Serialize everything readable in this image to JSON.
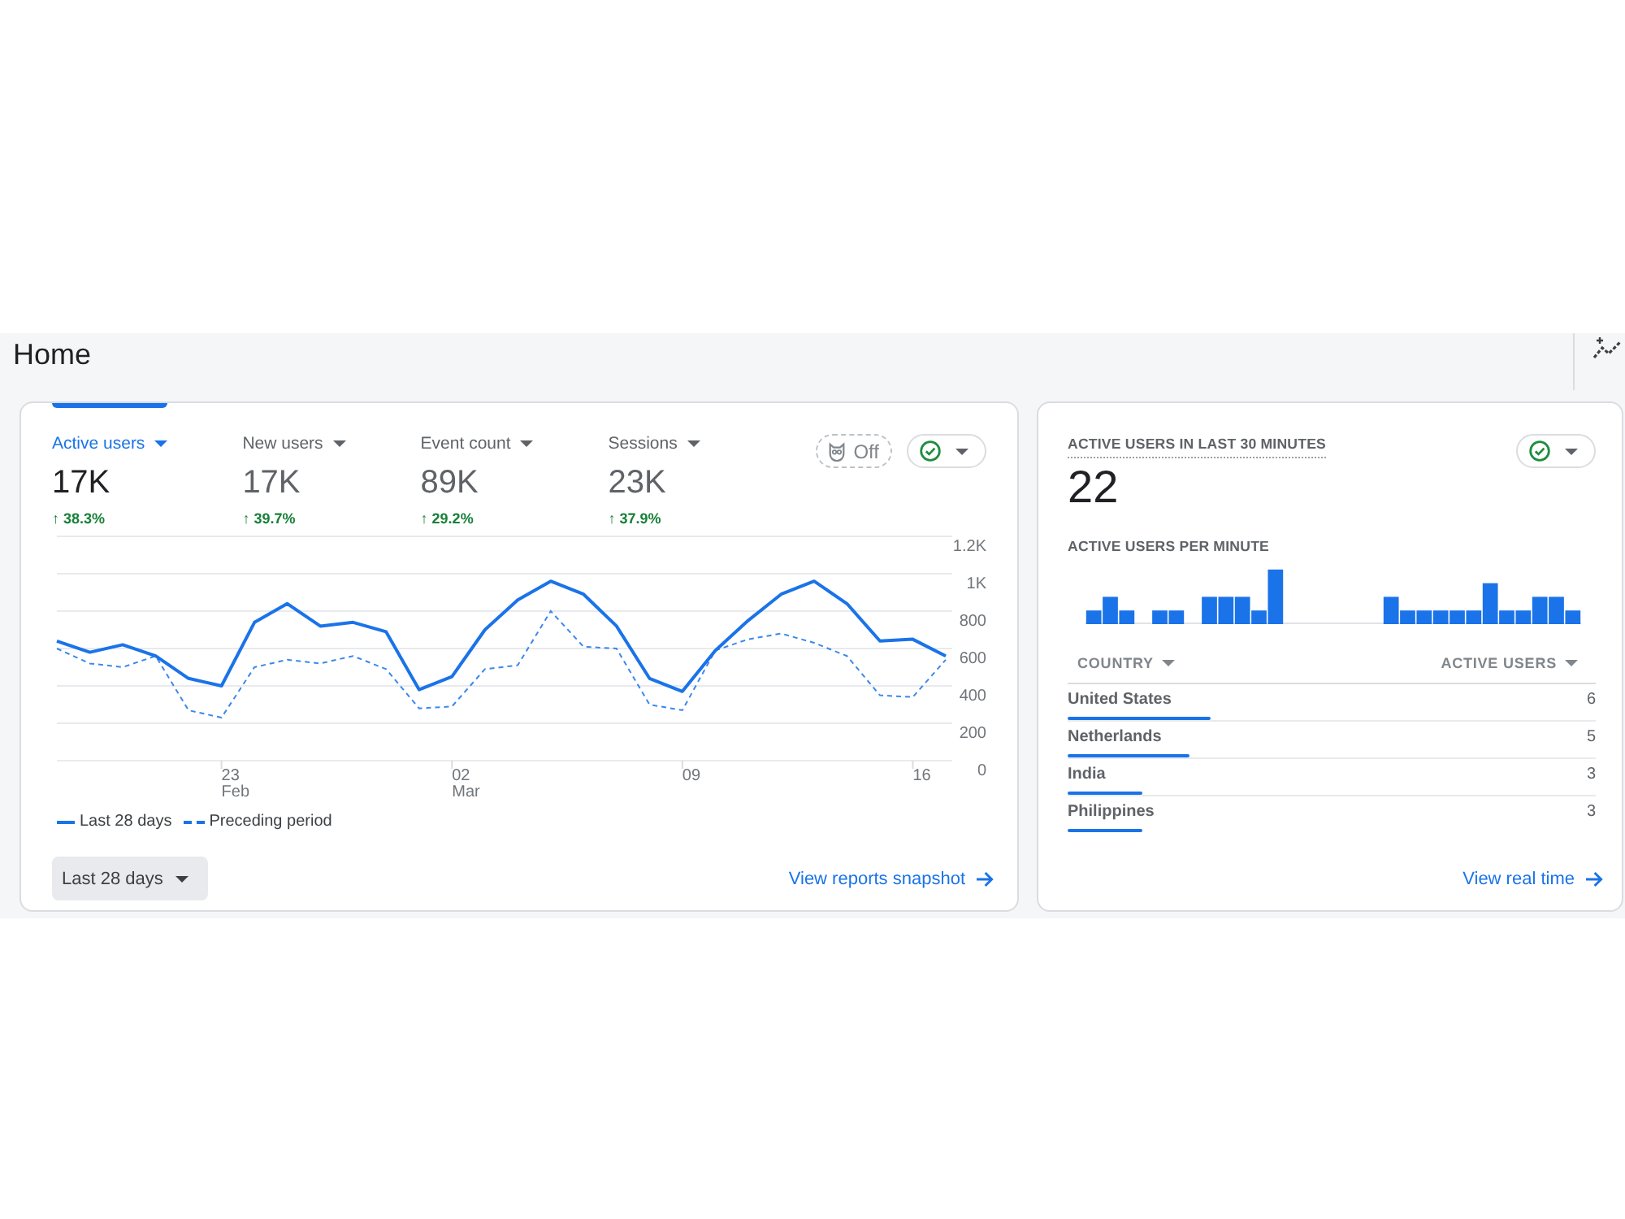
{
  "page": {
    "title": "Home"
  },
  "overview": {
    "metrics": [
      {
        "label": "Active users",
        "value": "17K",
        "change": "↑ 38.3%",
        "selected": true
      },
      {
        "label": "New users",
        "value": "17K",
        "change": "↑ 39.7%",
        "selected": false
      },
      {
        "label": "Event count",
        "value": "89K",
        "change": "↑ 29.2%",
        "selected": false
      },
      {
        "label": "Sessions",
        "value": "23K",
        "change": "↑ 37.9%",
        "selected": false
      }
    ],
    "insights_toggle": {
      "label": "Off"
    },
    "chart_data": {
      "type": "line",
      "grid": true,
      "categories": [
        null,
        null,
        null,
        null,
        null,
        "23\nFeb",
        null,
        null,
        null,
        null,
        null,
        null,
        "02\nMar",
        null,
        null,
        null,
        null,
        null,
        null,
        "09",
        null,
        null,
        null,
        null,
        null,
        null,
        "16",
        null
      ],
      "ylim": [
        0,
        1200
      ],
      "yticks": [
        0,
        200,
        400,
        600,
        800,
        {
          "value": 1000,
          "label": "1K"
        },
        {
          "value": 1200,
          "label": "1.2K"
        }
      ],
      "series": [
        {
          "name": "Last 28 days",
          "color": "#1a73e8",
          "line_style": "solid",
          "values": [
            640,
            580,
            620,
            560,
            440,
            400,
            740,
            840,
            720,
            740,
            690,
            380,
            450,
            700,
            860,
            960,
            890,
            720,
            440,
            370,
            590,
            750,
            890,
            960,
            840,
            640,
            650,
            560
          ]
        },
        {
          "name": "Preceding period",
          "color": "#1a73e8",
          "line_style": "dashed",
          "values": [
            600,
            520,
            500,
            560,
            270,
            230,
            500,
            540,
            520,
            560,
            490,
            280,
            290,
            490,
            510,
            800,
            610,
            600,
            300,
            270,
            590,
            650,
            680,
            630,
            560,
            350,
            340,
            540
          ]
        }
      ]
    },
    "date_range": {
      "label": "Last 28 days"
    },
    "link": "View reports snapshot"
  },
  "realtime": {
    "title": "ACTIVE USERS IN LAST 30 MINUTES",
    "value": "22",
    "chart_title": "ACTIVE USERS PER MINUTE",
    "columns": [
      "COUNTRY",
      "ACTIVE USERS"
    ],
    "rows": [
      {
        "country": "United States",
        "users": "6",
        "level": 0.27
      },
      {
        "country": "Netherlands",
        "users": "5",
        "level": 0.23
      },
      {
        "country": "India",
        "users": "3",
        "level": 0.14
      },
      {
        "country": "Philippines",
        "users": "3",
        "level": 0.14
      }
    ],
    "link": "View real time"
  }
}
